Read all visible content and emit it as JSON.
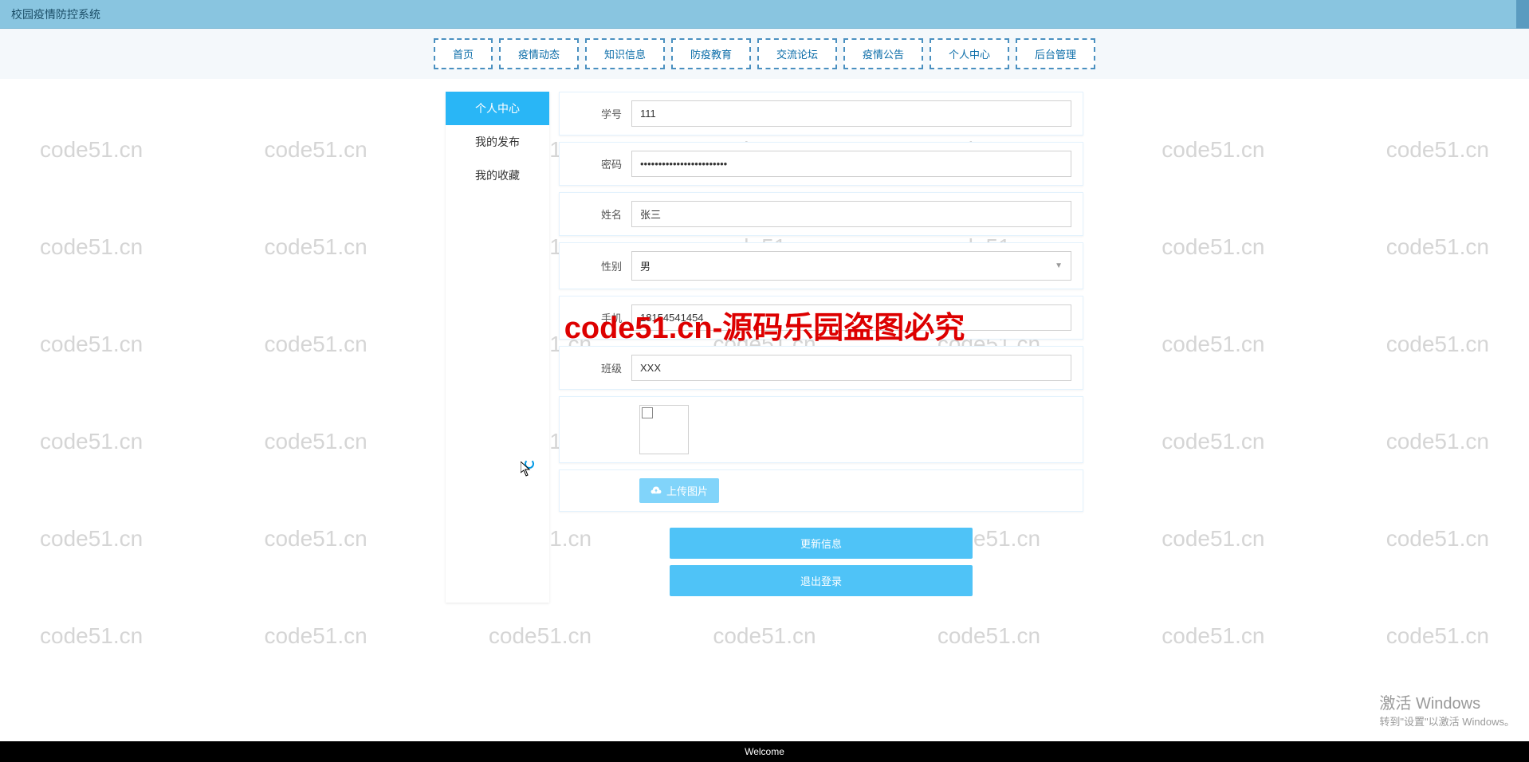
{
  "header": {
    "title": "校园疫情防控系统"
  },
  "nav": {
    "items": [
      "首页",
      "疫情动态",
      "知识信息",
      "防疫教育",
      "交流论坛",
      "疫情公告",
      "个人中心",
      "后台管理"
    ]
  },
  "sidebar": {
    "items": [
      {
        "label": "个人中心",
        "active": true
      },
      {
        "label": "我的发布",
        "active": false
      },
      {
        "label": "我的收藏",
        "active": false
      }
    ]
  },
  "form": {
    "student_id_label": "学号",
    "student_id_value": "111",
    "password_label": "密码",
    "password_value": "************************",
    "name_label": "姓名",
    "name_value": "张三",
    "gender_label": "性别",
    "gender_value": "男",
    "phone_label": "手机",
    "phone_value": "18154541454",
    "class_label": "班级",
    "class_value": "XXX",
    "upload_btn": "上传图片",
    "update_btn": "更新信息",
    "logout_btn": "退出登录"
  },
  "watermark": {
    "text": "code51.cn",
    "center": "code51.cn-源码乐园盗图必究"
  },
  "windows": {
    "line1": "激活 Windows",
    "line2": "转到\"设置\"以激活 Windows。"
  },
  "footer": {
    "text": "Welcome"
  }
}
